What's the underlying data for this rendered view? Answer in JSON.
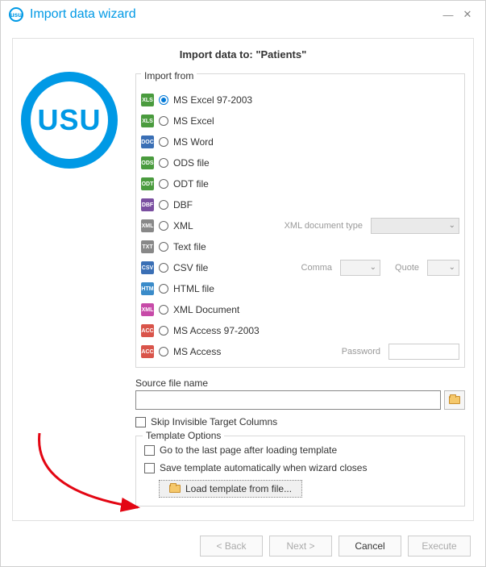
{
  "window": {
    "title": "Import data wizard",
    "heading_prefix": "Import data to: \"",
    "heading_target": "Patients",
    "heading_suffix": "\""
  },
  "logo_text": "USU",
  "import_from": {
    "label": "Import from",
    "options": [
      {
        "label": "MS Excel 97-2003",
        "color": "#4a9b3e",
        "tag": "XLS",
        "checked": true
      },
      {
        "label": "MS Excel",
        "color": "#4a9b3e",
        "tag": "XLS"
      },
      {
        "label": "MS Word",
        "color": "#3a6fb5",
        "tag": "DOC"
      },
      {
        "label": "ODS file",
        "color": "#4a9b3e",
        "tag": "ODS"
      },
      {
        "label": "ODT file",
        "color": "#4a9b3e",
        "tag": "ODT"
      },
      {
        "label": "DBF",
        "color": "#7a4ea0",
        "tag": "DBF"
      },
      {
        "label": "XML",
        "color": "#888",
        "tag": "XML",
        "side_label": "XML document type",
        "side_type": "combo_wide_disabled"
      },
      {
        "label": "Text file",
        "color": "#888",
        "tag": "TXT"
      },
      {
        "label": "CSV file",
        "color": "#3a6fb5",
        "tag": "CSV",
        "csv_row": true,
        "comma_label": "Comma",
        "quote_label": "Quote"
      },
      {
        "label": "HTML file",
        "color": "#3a8bc9",
        "tag": "HTM"
      },
      {
        "label": "XML Document",
        "color": "#c74aa8",
        "tag": "XML"
      },
      {
        "label": "MS Access 97-2003",
        "color": "#d9544a",
        "tag": "ACC"
      },
      {
        "label": "MS Access",
        "color": "#d9544a",
        "tag": "ACC",
        "side_label": "Password",
        "side_type": "password"
      }
    ]
  },
  "source": {
    "label": "Source file name",
    "value": ""
  },
  "skip_invisible": "Skip Invisible Target Columns",
  "template": {
    "label": "Template Options",
    "goto_last": "Go to the last page after loading template",
    "save_auto": "Save template automatically when wizard closes",
    "load_btn": "Load template from file..."
  },
  "footer": {
    "back": "< Back",
    "next": "Next >",
    "cancel": "Cancel",
    "execute": "Execute"
  }
}
